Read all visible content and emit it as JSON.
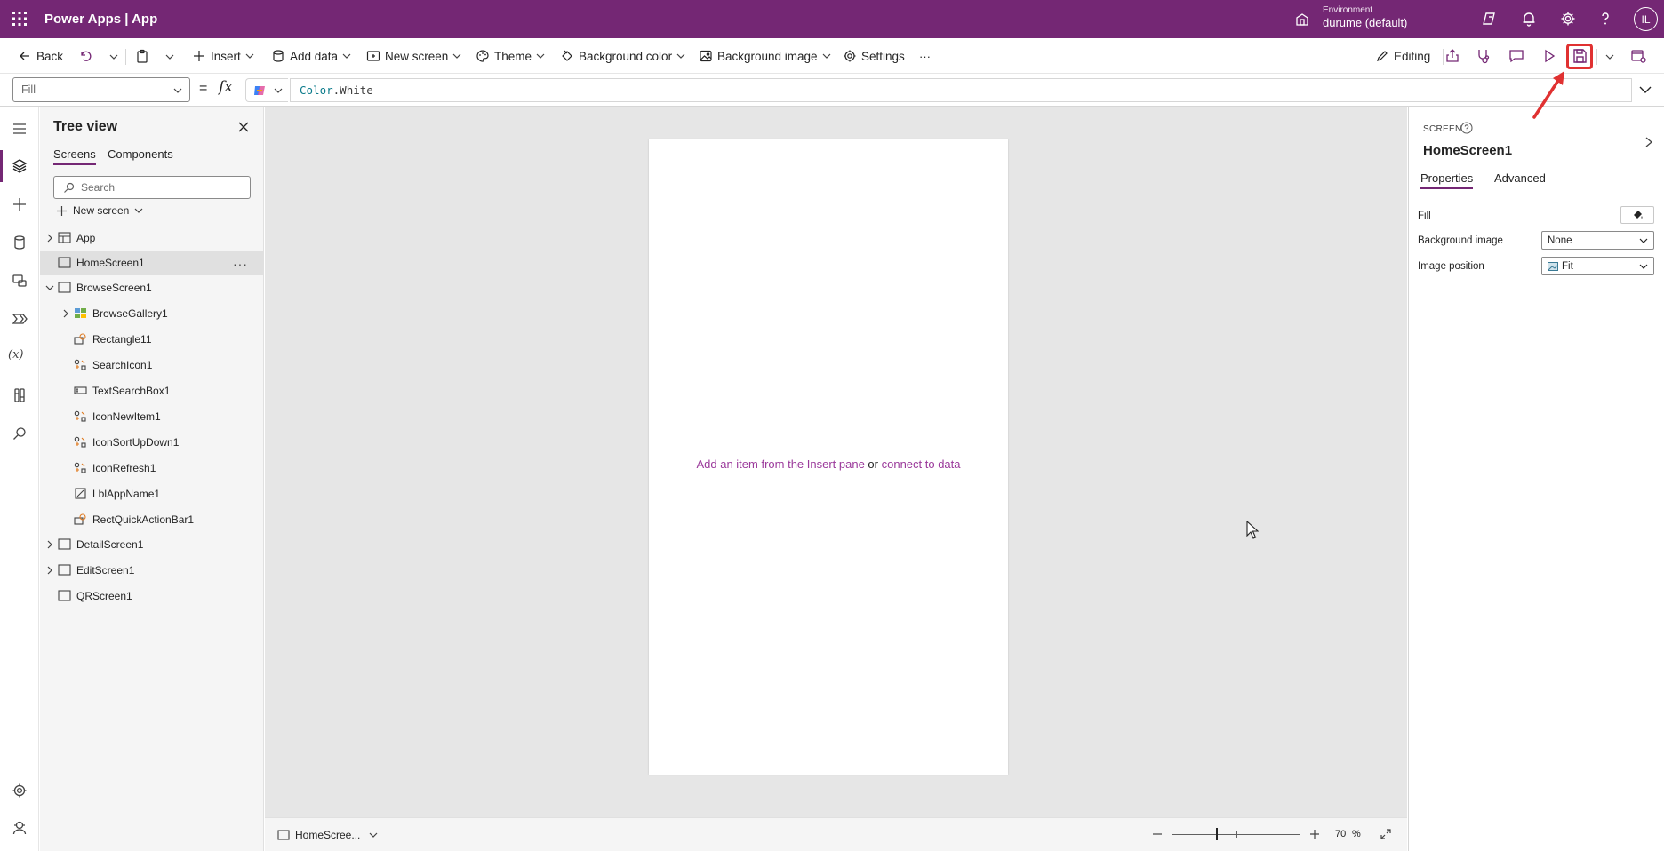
{
  "app": {
    "brand": "Power Apps  |  App"
  },
  "environment": {
    "label": "Environment",
    "name": "durume (default)"
  },
  "user": {
    "initials": "IL"
  },
  "topbar_icons": [
    "copilot-icon",
    "bell-icon",
    "gear-icon",
    "help-icon"
  ],
  "commandbar": {
    "back": "Back",
    "insert": "Insert",
    "add_data": "Add data",
    "new_screen": "New screen",
    "theme": "Theme",
    "background_color": "Background color",
    "background_image": "Background image",
    "settings": "Settings",
    "more": "···",
    "editing": "Editing"
  },
  "formula_bar": {
    "property": "Fill",
    "equals": "=",
    "fx": "fx",
    "formula_keyword": "Color",
    "formula_rest": ".White"
  },
  "tree_view": {
    "title": "Tree view",
    "tabs": [
      "Screens",
      "Components"
    ],
    "search_placeholder": "Search",
    "new_screen": "New screen",
    "items": [
      {
        "label": "App"
      },
      {
        "label": "HomeScreen1"
      },
      {
        "label": "BrowseScreen1"
      },
      {
        "label": "BrowseGallery1"
      },
      {
        "label": "Rectangle11"
      },
      {
        "label": "SearchIcon1"
      },
      {
        "label": "TextSearchBox1"
      },
      {
        "label": "IconNewItem1"
      },
      {
        "label": "IconSortUpDown1"
      },
      {
        "label": "IconRefresh1"
      },
      {
        "label": "LblAppName1"
      },
      {
        "label": "RectQuickActionBar1"
      },
      {
        "label": "DetailScreen1"
      },
      {
        "label": "EditScreen1"
      },
      {
        "label": "QRScreen1"
      }
    ]
  },
  "canvas": {
    "hint_prefix": "Add an item from the Insert pane",
    "hint_or": " or ",
    "hint_link": "connect to data"
  },
  "statusbar": {
    "screen": "HomeScree...",
    "zoom_value": "70",
    "zoom_unit": "%"
  },
  "properties": {
    "type_label": "SCREEN",
    "name": "HomeScreen1",
    "tabs": [
      "Properties",
      "Advanced"
    ],
    "fill_label": "Fill",
    "bg_image_label": "Background image",
    "bg_image_value": "None",
    "image_position_label": "Image position",
    "image_position_value": "Fit"
  },
  "colors": {
    "brand": "#742774",
    "annotation": "#e03131",
    "link": "#9b3a9b"
  }
}
